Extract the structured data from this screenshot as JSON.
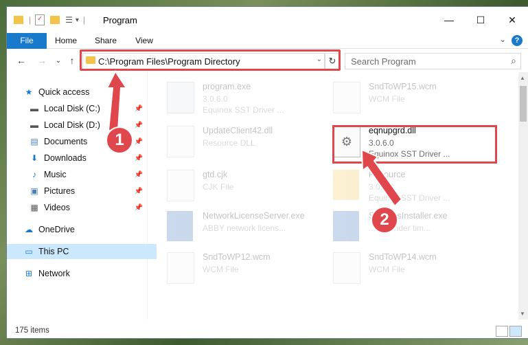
{
  "window": {
    "title": "Program",
    "buttons": {
      "minimize": "—",
      "maximize": "☐",
      "close": "✕"
    }
  },
  "ribbon": {
    "tabs": [
      "File",
      "Home",
      "Share",
      "View"
    ],
    "help": "?"
  },
  "address": {
    "path": "C:\\Program Files\\Program Directory"
  },
  "search": {
    "placeholder": "Search Program"
  },
  "nav": {
    "quick_access": "Quick access",
    "items": [
      "Local Disk (C:)",
      "Local Disk (D:)",
      "Documents",
      "Downloads",
      "Music",
      "Pictures",
      "Videos"
    ],
    "onedrive": "OneDrive",
    "this_pc": "This PC",
    "network": "Network"
  },
  "files": [
    {
      "name": "program.exe",
      "line1": "3.0.6.0",
      "line2": "Equinox SST Driver ..."
    },
    {
      "name": "SndToWP15.wcm",
      "line1": "WCM File",
      "line2": ""
    },
    {
      "name": "UpdateClient42.dll",
      "line1": "Resource DLL",
      "line2": ""
    },
    {
      "name": "eqnupgrd.dll",
      "line1": "3.0.6.0",
      "line2": "Equinox SST Driver ..."
    },
    {
      "name": "gtd.cjk",
      "line1": "CJK File",
      "line2": ""
    },
    {
      "name": "Resource",
      "line1": "3.0.6.0",
      "line2": "Equinox SST Driver ..."
    },
    {
      "name": "NetworkLicenseServer.exe",
      "line1": "ABBY network licens...",
      "line2": ""
    },
    {
      "name": "SystemsInstaller.exe",
      "line1": "...mmender tim...",
      "line2": ""
    },
    {
      "name": "SndToWP12.wcm",
      "line1": "WCM File",
      "line2": ""
    },
    {
      "name": "SndToWP14.wcm",
      "line1": "WCM File",
      "line2": ""
    }
  ],
  "status": {
    "count": "175 items"
  },
  "callouts": [
    "1",
    "2"
  ],
  "colors": {
    "accent": "#1979ca",
    "highlight": "#e0474c",
    "folder": "#f3c34a"
  }
}
